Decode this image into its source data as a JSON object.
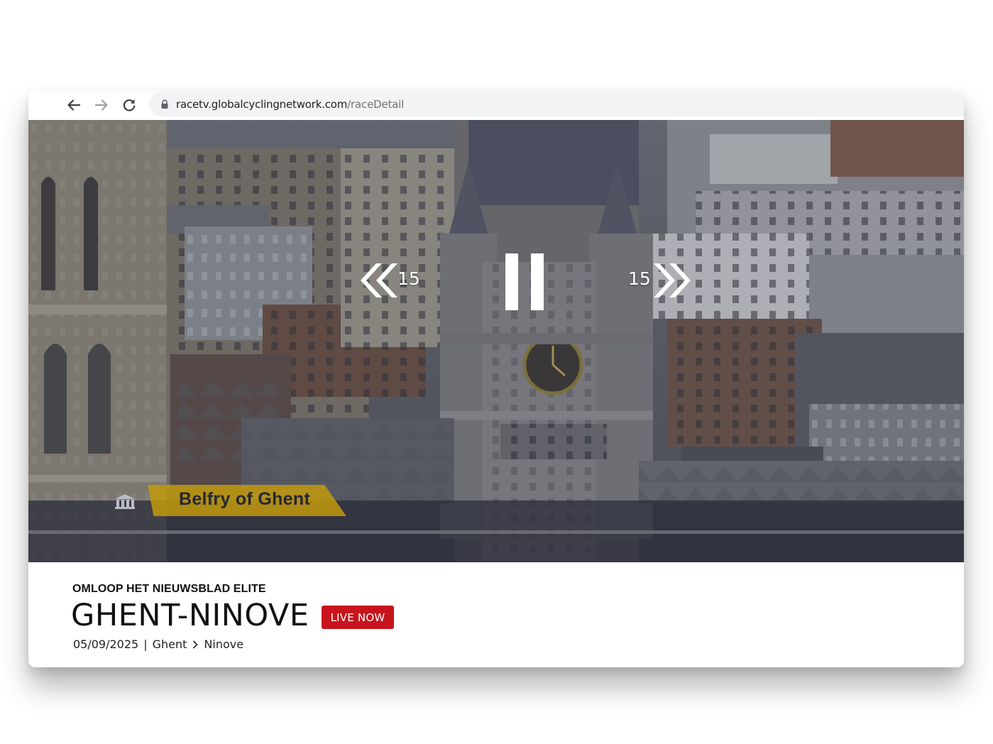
{
  "browser": {
    "url_host": "racetv.globalcyclingnetwork.com",
    "url_path": "/raceDetail"
  },
  "player": {
    "skip_back_seconds": "15",
    "skip_forward_seconds": "15",
    "caption": "Belfry of Ghent"
  },
  "race": {
    "series": "OMLOOP HET NIEUWSBLAD ELITE",
    "title": "GHENT-NINOVE",
    "live_badge": "LIVE NOW",
    "date": "05/09/2025",
    "separator": "|",
    "start": "Ghent",
    "finish": "Ninove"
  },
  "colors": {
    "live_badge": "#c8151d",
    "caption_tag": "#c29a0d",
    "address_bar": "#f1f3f4"
  },
  "icons": {
    "back": "arrow-left-icon",
    "forward": "arrow-right-icon",
    "reload": "reload-icon",
    "lock": "lock-icon",
    "skip_back": "double-chevron-left-icon",
    "pause": "pause-icon",
    "skip_forward": "double-chevron-right-icon",
    "route": "chevron-right-icon",
    "caption": "building-icon"
  }
}
